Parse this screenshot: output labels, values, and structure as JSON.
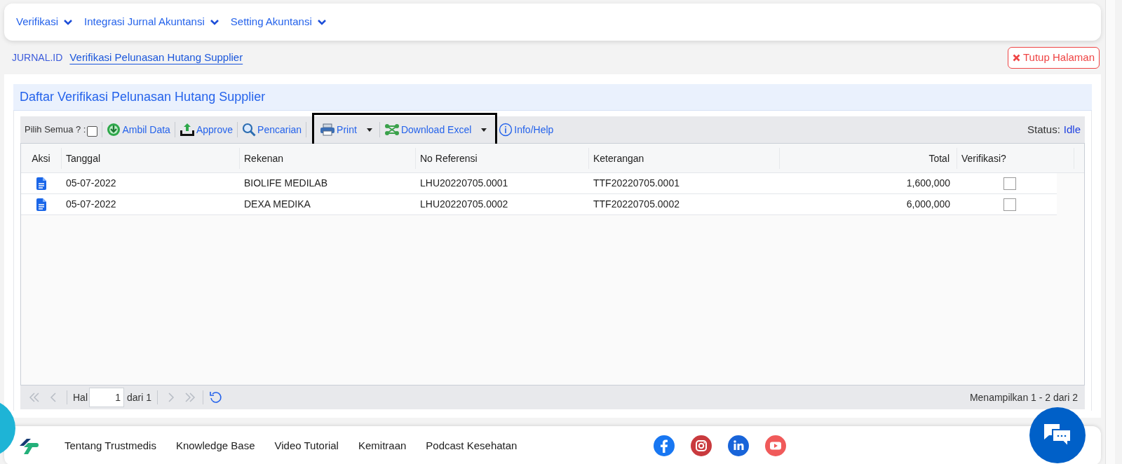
{
  "nav": {
    "menus": [
      {
        "label": "Verifikasi"
      },
      {
        "label": "Integrasi Jurnal Akuntansi"
      },
      {
        "label": "Setting Akuntansi"
      }
    ]
  },
  "breadcrumb": {
    "root": "JURNAL.ID",
    "current": "Verifikasi Pelunasan Hutang Supplier"
  },
  "close_button": {
    "label": "Tutup Halaman"
  },
  "panel": {
    "title": "Daftar Verifikasi Pelunasan Hutang Supplier"
  },
  "toolbar": {
    "select_all": {
      "label": "Pilih Semua ? :",
      "checked": false
    },
    "items": [
      {
        "label": "Ambil Data",
        "kind": "fetch",
        "highlighted": false
      },
      {
        "label": "Approve",
        "kind": "approve",
        "highlighted": false
      },
      {
        "label": "Pencarian",
        "kind": "search",
        "highlighted": false
      },
      {
        "label": "Print",
        "kind": "print",
        "highlighted": true
      },
      {
        "label": "Download Excel",
        "kind": "excel",
        "highlighted": true
      },
      {
        "label": "Info/Help",
        "kind": "info",
        "highlighted": false
      }
    ],
    "status_label": "Status:",
    "status_value": "Idle"
  },
  "table": {
    "columns": [
      "Aksi",
      "Tanggal",
      "Rekenan",
      "No Referensi",
      "Keterangan",
      "Total",
      "Verifikasi?"
    ],
    "rows": [
      {
        "tanggal": "05-07-2022",
        "rekenan": "BIOLIFE MEDILAB",
        "no_referensi": "LHU20220705.0001",
        "keterangan": "TTF20220705.0001",
        "total": "1,600,000",
        "verified": false
      },
      {
        "tanggal": "05-07-2022",
        "rekenan": "DEXA MEDIKA",
        "no_referensi": "LHU20220705.0002",
        "keterangan": "TTF20220705.0002",
        "total": "6,000,000",
        "verified": false
      }
    ]
  },
  "pager": {
    "page_label": "Hal",
    "page": "1",
    "of": "dari 1",
    "summary": "Menampilkan 1 - 2 dari 2"
  },
  "footer": {
    "links": [
      "Tentang Trustmedis",
      "Knowledge Base",
      "Video Tutorial",
      "Kemitraan",
      "Podcast Kesehatan"
    ]
  }
}
